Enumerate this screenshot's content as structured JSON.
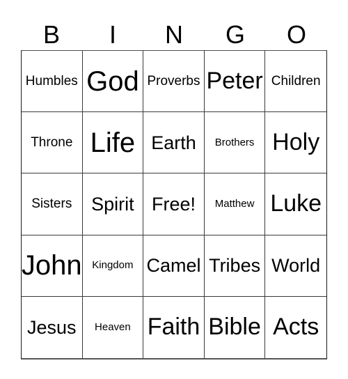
{
  "card": {
    "title": "BINGO",
    "columns": [
      "B",
      "I",
      "N",
      "G",
      "O"
    ],
    "rows": [
      [
        {
          "label": "Humbles",
          "size": "sm"
        },
        {
          "label": "God",
          "size": "xl"
        },
        {
          "label": "Proverbs",
          "size": "sm"
        },
        {
          "label": "Peter",
          "size": "lg"
        },
        {
          "label": "Children",
          "size": "sm"
        }
      ],
      [
        {
          "label": "Throne",
          "size": "sm"
        },
        {
          "label": "Life",
          "size": "xl"
        },
        {
          "label": "Earth",
          "size": "md"
        },
        {
          "label": "Brothers",
          "size": "xs"
        },
        {
          "label": "Holy",
          "size": "lg"
        }
      ],
      [
        {
          "label": "Sisters",
          "size": "sm"
        },
        {
          "label": "Spirit",
          "size": "md"
        },
        {
          "label": "Free!",
          "size": "md"
        },
        {
          "label": "Matthew",
          "size": "xs"
        },
        {
          "label": "Luke",
          "size": "lg"
        }
      ],
      [
        {
          "label": "John",
          "size": "xl"
        },
        {
          "label": "Kingdom",
          "size": "xs"
        },
        {
          "label": "Camel",
          "size": "md"
        },
        {
          "label": "Tribes",
          "size": "md"
        },
        {
          "label": "World",
          "size": "md"
        }
      ],
      [
        {
          "label": "Jesus",
          "size": "md"
        },
        {
          "label": "Heaven",
          "size": "xs"
        },
        {
          "label": "Faith",
          "size": "lg"
        },
        {
          "label": "Bible",
          "size": "lg"
        },
        {
          "label": "Acts",
          "size": "lg"
        }
      ]
    ],
    "free_space": "Free!",
    "colors": {
      "background": "#ffffff",
      "text": "#000000",
      "grid_line": "#3a3a3a"
    }
  }
}
